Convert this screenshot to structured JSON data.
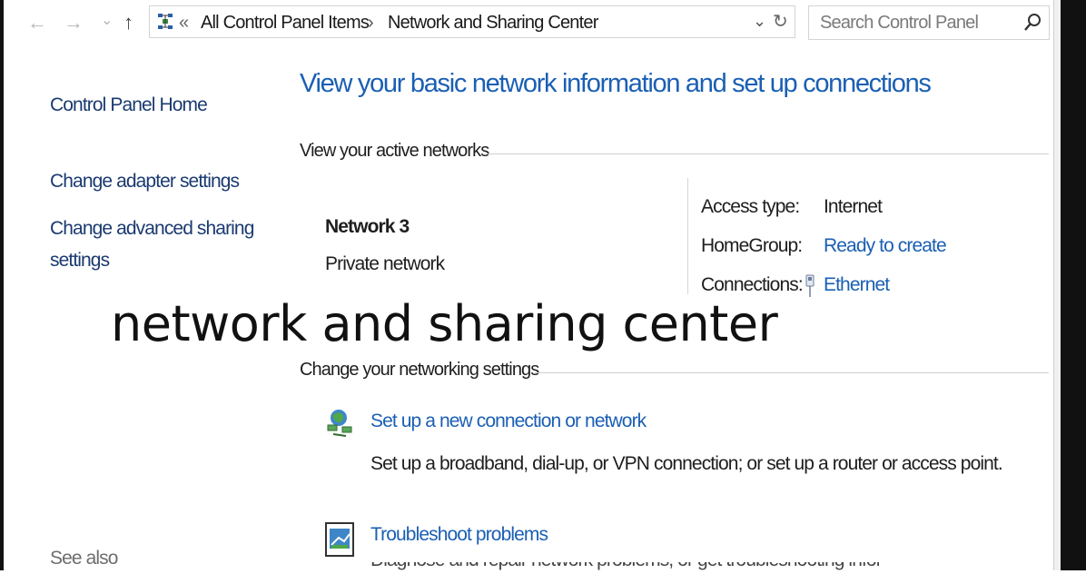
{
  "toolbar": {
    "back_glyph": "←",
    "forward_glyph": "→",
    "recent_glyph": "⌄",
    "up_glyph": "↑"
  },
  "address": {
    "overflow": "«",
    "crumb1": "All Control Panel Items",
    "separator": "›",
    "crumb2": "Network and Sharing Center",
    "dropdown_glyph": "⌄",
    "refresh_glyph": "↻"
  },
  "search": {
    "placeholder": "Search Control Panel"
  },
  "sidebar": {
    "home": "Control Panel Home",
    "adapter": "Change adapter settings",
    "advanced_line1": "Change advanced sharing",
    "advanced_line2": "settings",
    "see_also": "See also"
  },
  "main": {
    "heading": "View your basic network information and set up connections",
    "active_title": "View your active networks",
    "network": {
      "name": "Network  3",
      "type": "Private network",
      "access_label": "Access type:",
      "access_value": "Internet",
      "homegroup_label": "HomeGroup:",
      "homegroup_value": "Ready to create",
      "connections_label": "Connections:",
      "connections_value": "Ethernet"
    },
    "change_title": "Change your networking settings",
    "tasks": [
      {
        "link": "Set up a new connection or network",
        "description": "Set up a broadband, dial-up, or VPN connection; or set up a router or access point."
      },
      {
        "link": "Troubleshoot problems",
        "description": "Diagnose and repair network problems, or get troubleshooting information."
      }
    ]
  },
  "overlay_caption": "network and sharing center",
  "colors": {
    "link": "#1a5fb4",
    "heading": "#1a5fb4",
    "sidebar_link": "#1a3a70"
  },
  "icons": [
    "back-arrow",
    "forward-arrow",
    "up-arrow",
    "network-location-icon",
    "refresh-icon",
    "search-icon",
    "ethernet-icon",
    "new-connection-icon",
    "troubleshoot-icon"
  ]
}
